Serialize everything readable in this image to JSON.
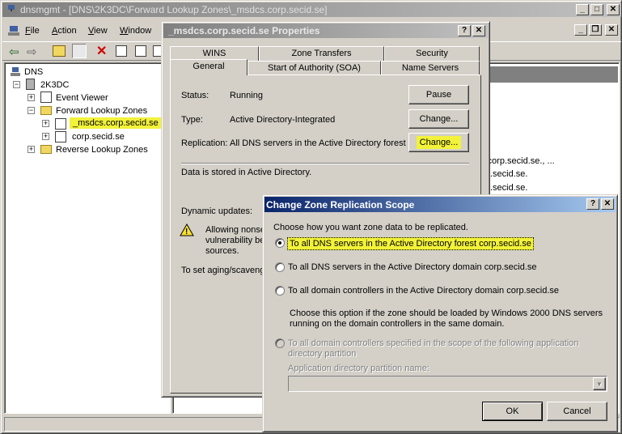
{
  "main_window": {
    "title": "dnsmgmt - [DNS\\2K3DC\\Forward Lookup Zones\\_msdcs.corp.secid.se]",
    "menu": [
      "File",
      "Action",
      "View",
      "Window"
    ],
    "menu_underline": [
      "F",
      "A",
      "V",
      "W"
    ]
  },
  "tree": {
    "root": "DNS",
    "server": "2K3DC",
    "event_viewer": "Event Viewer",
    "forward_zones": "Forward Lookup Zones",
    "zone_msdcs": "_msdcs.corp.secid.se",
    "zone_corp": "corp.secid.se",
    "reverse_zones": "Reverse Lookup Zones"
  },
  "right_pane": {
    "lines": [
      "c.corp.secid.se., ...",
      ".secid.se.",
      ".secid.se."
    ]
  },
  "properties": {
    "title": "_msdcs.corp.secid.se Properties",
    "tabs_row1": [
      "WINS",
      "Zone Transfers",
      "Security"
    ],
    "tabs_row2": [
      "General",
      "Start of Authority (SOA)",
      "Name Servers"
    ],
    "status_label": "Status:",
    "status_value": "Running",
    "pause_button": "Pause",
    "type_label": "Type:",
    "type_value": "Active Directory-Integrated",
    "change_button": "Change...",
    "replication_label": "Replication:",
    "replication_value": "All DNS servers in the Active Directory forest",
    "stored_text": "Data is stored in Active Directory.",
    "dynamic_updates_label": "Dynamic updates:",
    "warning_text": "Allowing nonse vulnerabilty be sources.",
    "warning_lines": [
      "Allowing nonse",
      "vulnerability be",
      "sources."
    ],
    "aging_text": "To set aging/scaveng"
  },
  "scope_dialog": {
    "title": "Change Zone Replication Scope",
    "prompt": "Choose how you want zone data to be replicated.",
    "options": [
      {
        "label": "To all DNS servers in the Active Directory forest corp.secid.se",
        "selected": true,
        "enabled": true
      },
      {
        "label": "To all DNS servers in the Active Directory domain corp.secid.se",
        "selected": false,
        "enabled": true
      },
      {
        "label": "To all domain controllers in the Active Directory domain corp.secid.se",
        "selected": false,
        "enabled": true
      },
      {
        "label": "To all domain controllers specified in the scope of the following application directory partition",
        "selected": false,
        "enabled": false
      }
    ],
    "option3_note_line1": "Choose this option if the zone should be loaded by Windows 2000 DNS servers",
    "option3_note_line2": "running on the domain controllers in the same domain.",
    "option4_line1": "To all domain controllers specified in the scope of the following application",
    "option4_line2": "directory partition",
    "partition_label": "Application directory partition name:",
    "partition_value": "",
    "ok_button": "OK",
    "cancel_button": "Cancel"
  },
  "colors": {
    "highlight": "#f2f23a",
    "active_title": "#0a246a",
    "inactive_title": "#808080"
  }
}
